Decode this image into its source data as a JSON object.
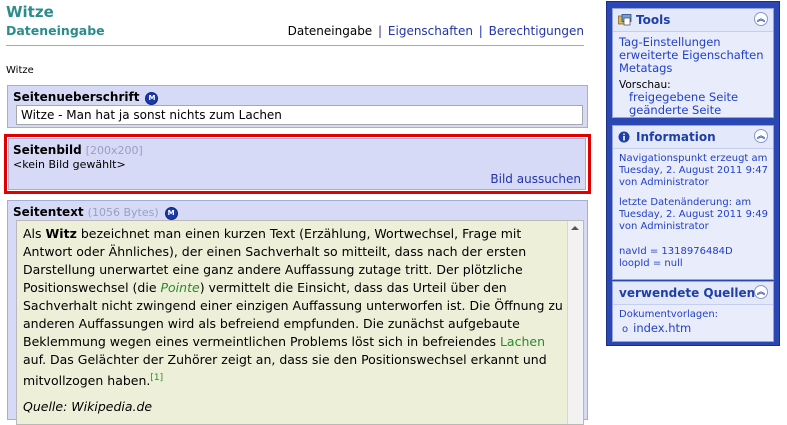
{
  "header": {
    "title": "Witze",
    "subtitle": "Dateneingabe",
    "nav": {
      "current": "Dateneingabe",
      "separator": "|",
      "properties": "Eigenschaften",
      "permissions": "Berechtigungen"
    },
    "breadcrumb": "Witze"
  },
  "fields": {
    "heading": {
      "label": "Seitenueberschrift",
      "value": "Witze - Man hat ja sonst nichts zum Lachen"
    },
    "image": {
      "label": "Seitenbild",
      "size_hint": "[200x200]",
      "empty_text": "<kein Bild gewählt>",
      "search_link": "Bild aussuchen"
    },
    "text": {
      "label": "Seitentext",
      "size_hint": "(1056 Bytes)",
      "p1_a": "Als ",
      "p1_bold": "Witz",
      "p1_b": " bezeichnet man einen kurzen Text (Erzählung, Wortwechsel, Frage mit Antwort oder Ähnliches), der einen Sachverhalt so mitteilt, dass nach der ersten Darstellung unerwartet eine ganz andere Auffassung zutage tritt. Der plötzliche Positionswechsel (die ",
      "p1_link_pointe": "Pointe",
      "p1_c": ") vermittelt die Einsicht, dass das Urteil über den Sachverhalt nicht zwingend einer einzigen Auffassung unterworfen ist. Die Öffnung zu anderen Auffassungen wird als befreiend empfunden. Die zunächst aufgebaute Beklemmung wegen eines vermeintlichen Problems löst sich in befreiendes ",
      "p1_link_lachen": "Lachen",
      "p1_d": " auf. Das Gelächter der Zuhörer zeigt an, dass sie den Positionswechsel erkannt und mitvollzogen haben.",
      "footnote": "[1]",
      "source": "Quelle: Wikipedia.de"
    }
  },
  "sidebar": {
    "tools": {
      "title": "Tools",
      "links": [
        "Tag-Einstellungen",
        "erweiterte Eigenschaften",
        "Metatags"
      ],
      "preview_label": "Vorschau:",
      "preview_links": [
        "freigegebene Seite",
        "geänderte Seite"
      ]
    },
    "info": {
      "title": "Information",
      "created": "Navigationspunkt erzeugt am Tuesday, 2. August 2011 9:47 von Administrator",
      "changed": "letzte Datenänderung: am Tuesday, 2. August 2011 9:49 von Administrator",
      "nav_id": "navId = 1318976484D",
      "loop_id": "loopId = null"
    },
    "sources": {
      "title": "verwendete Quellen",
      "label": "Dokumentvorlagen:",
      "items": [
        "index.htm"
      ]
    }
  },
  "colors": {
    "title_teal": "#2c8c8c",
    "field_bg": "#d6daf6",
    "text_area_bg": "#eeefd9",
    "sidebar_blue": "#2a47b3",
    "highlight_red": "#e10000",
    "link_blue": "#2340c8",
    "link_green": "#2a8a2a"
  },
  "icons": {
    "meta": "m-circle-icon",
    "tools": "tools-icon",
    "info": "info-icon",
    "collapse": "double-chevron-up-icon"
  }
}
